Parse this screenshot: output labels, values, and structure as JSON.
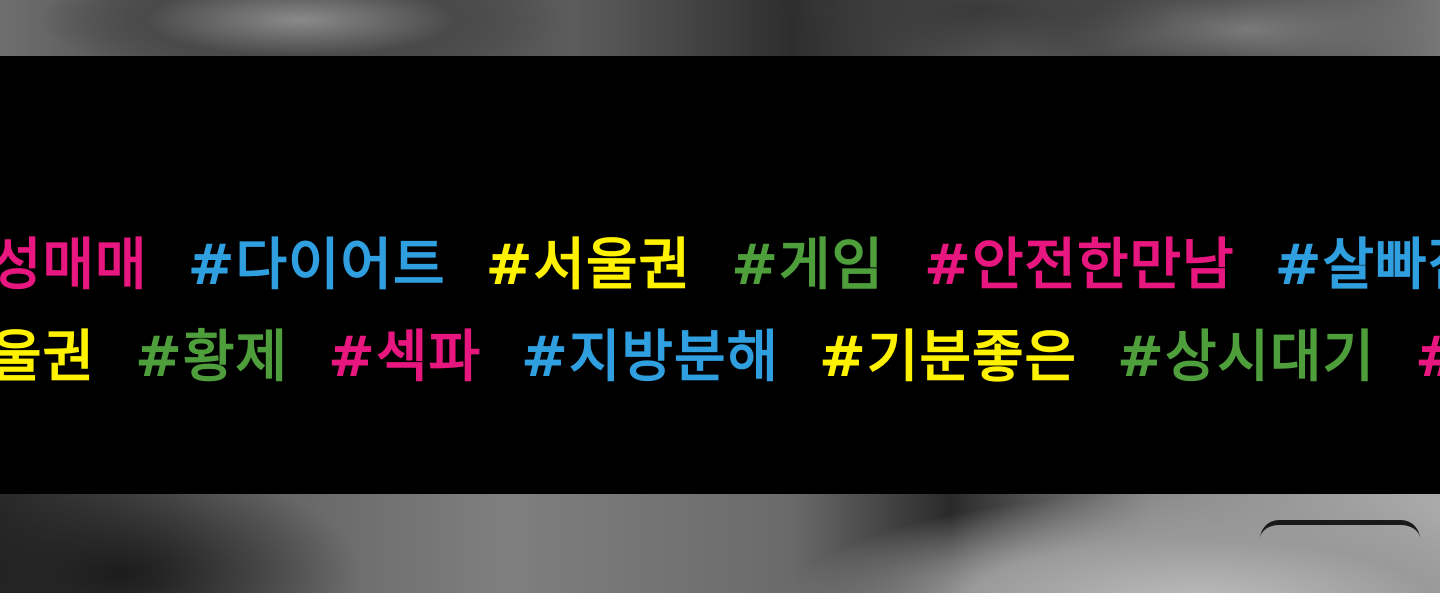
{
  "colors": {
    "pink": "#e8167f",
    "blue": "#2f9fe0",
    "yellow": "#fff200",
    "green": "#4f9e3c",
    "banner": "#000000"
  },
  "rows": [
    {
      "tags": [
        {
          "text": "성매매",
          "color": "pink"
        },
        {
          "text": "#다이어트",
          "color": "blue"
        },
        {
          "text": "#서울권",
          "color": "yellow"
        },
        {
          "text": "#게임",
          "color": "green"
        },
        {
          "text": "#안전한만남",
          "color": "pink"
        },
        {
          "text": "#살빠짐",
          "color": "blue"
        }
      ]
    },
    {
      "tags": [
        {
          "text": "울권",
          "color": "yellow"
        },
        {
          "text": "#황제",
          "color": "green"
        },
        {
          "text": "#섹파",
          "color": "pink"
        },
        {
          "text": "#지방분해",
          "color": "blue"
        },
        {
          "text": "#기분좋은",
          "color": "yellow"
        },
        {
          "text": "#상시대기",
          "color": "green"
        },
        {
          "text": "#바",
          "color": "pink"
        }
      ]
    }
  ]
}
